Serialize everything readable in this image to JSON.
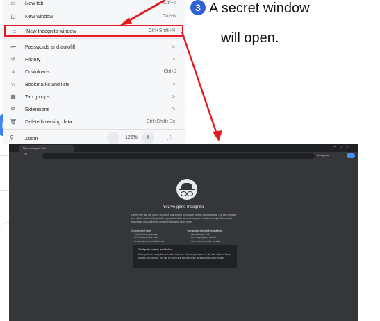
{
  "menu": {
    "items": [
      {
        "icon": "new-tab-icon",
        "label": "New tab",
        "shortcut": "Ctrl+T"
      },
      {
        "icon": "new-window-icon",
        "label": "New window",
        "shortcut": "Ctrl+N"
      },
      {
        "icon": "incognito-icon",
        "label": "New Incognito window",
        "shortcut": "Ctrl+Shift+N"
      },
      {
        "icon": "key-icon",
        "label": "Passwords and autofill",
        "shortcut": ">"
      },
      {
        "icon": "history-icon",
        "label": "History",
        "shortcut": ">"
      },
      {
        "icon": "download-icon",
        "label": "Downloads",
        "shortcut": "Ctrl+J"
      },
      {
        "icon": "star-icon",
        "label": "Bookmarks and lists",
        "shortcut": ">"
      },
      {
        "icon": "tab-groups-icon",
        "label": "Tab groups",
        "shortcut": ">"
      },
      {
        "icon": "extensions-icon",
        "label": "Extensions",
        "shortcut": ">"
      },
      {
        "icon": "trash-icon",
        "label": "Delete browsing data...",
        "shortcut": "Ctrl+Shift+Del"
      }
    ],
    "zoom": {
      "label": "Zoom",
      "value": "125%",
      "minus": "−",
      "plus": "+"
    }
  },
  "callout": {
    "number": "3",
    "line1": "A secret window",
    "line2": "will open."
  },
  "incognito": {
    "tab_title": "New Incognito Tab",
    "badge": "Incognito",
    "title": "You've gone Incognito",
    "intro": "Others who use this device won't see your activity, so you can browse more privately. This won't change how data is collected by websites you visit and the services they use, including Google. Downloads, bookmarks and reading list items will be saved. Learn more",
    "col1_head": "Chrome won't save:",
    "col1_items": [
      "Your browsing history",
      "Cookies and site data",
      "Information entered in forms"
    ],
    "col2_head": "Your activity might still be visible to:",
    "col2_items": [
      "Websites you visit",
      "Your employer or school",
      "Your internet service provider"
    ],
    "cookie_head": "Third-party cookies are blocked",
    "cookie_body": "When you're in Incognito mode, sites can't use third-party cookies. If a site that relies on these cookies isn't working, you can try giving that site temporary access to third-party cookies."
  },
  "colors": {
    "highlight": "#e31b23",
    "step": "#2f60d8",
    "incognito_bg": "#35363a"
  }
}
